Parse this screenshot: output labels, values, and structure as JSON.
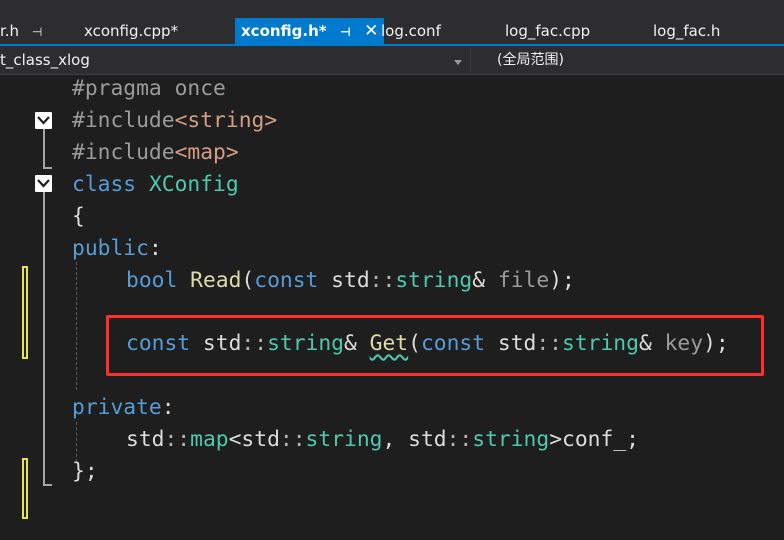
{
  "tabs": [
    {
      "label": "r.h",
      "pinned": true
    },
    {
      "label": "xconfig.cpp*"
    },
    {
      "label": "xconfig.h*",
      "pinned": true,
      "active": true
    },
    {
      "label": "log.conf"
    },
    {
      "label": "log_fac.cpp"
    },
    {
      "label": "log_fac.h"
    }
  ],
  "icons": {
    "pin": "📌",
    "pin_glyph": "⊣",
    "close": "✕"
  },
  "navbar": {
    "scope": "t_class_xlog",
    "member": "(全局范围)"
  },
  "code": {
    "l1": {
      "directive": "#pragma",
      "rest": " once"
    },
    "l2": {
      "directive": "#include",
      "open": "<",
      "header": "string",
      "close": ">"
    },
    "l3": {
      "directive": "#include",
      "open": "<",
      "header": "map",
      "close": ">"
    },
    "l4": {
      "keyword": "class",
      "name": "XConfig"
    },
    "l5": {
      "text": "{"
    },
    "l6": {
      "keyword": "public",
      "colon": ":"
    },
    "l7": {
      "type": "bool",
      "func": "Read",
      "p1": "(",
      "kw": "const",
      "ns": " std",
      "scope": "::",
      "ty": "string",
      "amp": "&",
      "param": " file",
      "end": ");"
    },
    "l8": {
      "kw1": "const",
      "ns1": " std",
      "sc1": "::",
      "ty1": "string",
      "amp1": "&",
      "func": "Get",
      "p1": "(",
      "kw2": "const",
      "ns2": " std",
      "sc2": "::",
      "ty2": "string",
      "amp2": "&",
      "param": " key",
      "end": ");"
    },
    "l9": {
      "keyword": "private",
      "colon": ":"
    },
    "l10": {
      "ns1": "std",
      "sc1": "::",
      "ty1": "map",
      "lt": "<",
      "ns2": "std",
      "sc2": "::",
      "ty2": "string",
      "comma": ", ",
      "ns3": "std",
      "sc3": "::",
      "ty3": "string",
      "gt": ">",
      "member": "conf_;"
    },
    "l11": {
      "text": "};"
    }
  },
  "colors": {
    "active_tab": "#007acc",
    "highlight_box": "#ff2d2d",
    "change_bar": "#e4e44e"
  }
}
